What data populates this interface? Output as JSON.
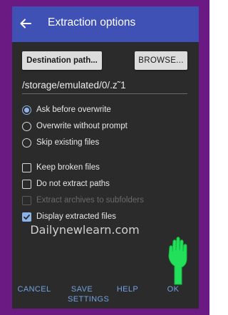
{
  "header": {
    "title": "Extraction options",
    "back_icon": "arrow-left-icon"
  },
  "destination": {
    "destination_label": "Destination path...",
    "browse_label": "BROWSE...",
    "path_value": "/storage/emulated/0/.z˜1"
  },
  "overwrite_mode": {
    "selected": "Ask before overwrite",
    "options": [
      {
        "label": "Ask before overwrite",
        "selected": true
      },
      {
        "label": "Overwrite without prompt",
        "selected": false
      },
      {
        "label": "Skip existing files",
        "selected": false
      }
    ]
  },
  "options": [
    {
      "label": "Keep broken files",
      "checked": false,
      "enabled": true
    },
    {
      "label": "Do not extract paths",
      "checked": false,
      "enabled": true
    },
    {
      "label": "Extract archives to subfolders",
      "checked": false,
      "enabled": false
    },
    {
      "label": "Display extracted files",
      "checked": true,
      "enabled": true
    }
  ],
  "watermark": "Dailynewlearn.com",
  "actions": {
    "cancel": "CANCEL",
    "save_line1": "SAVE",
    "save_line2": "SETTINGS",
    "help": "HELP",
    "ok": "OK"
  },
  "colors": {
    "frame": "#6a1a82",
    "titlebar": "#3f51b5",
    "dialog_bg": "#2b2b2b",
    "accent": "#8cb4e8",
    "action_text": "#6fa3e0",
    "pointer_hand": "#22e05a"
  },
  "pointer": "pointing-hand-icon"
}
